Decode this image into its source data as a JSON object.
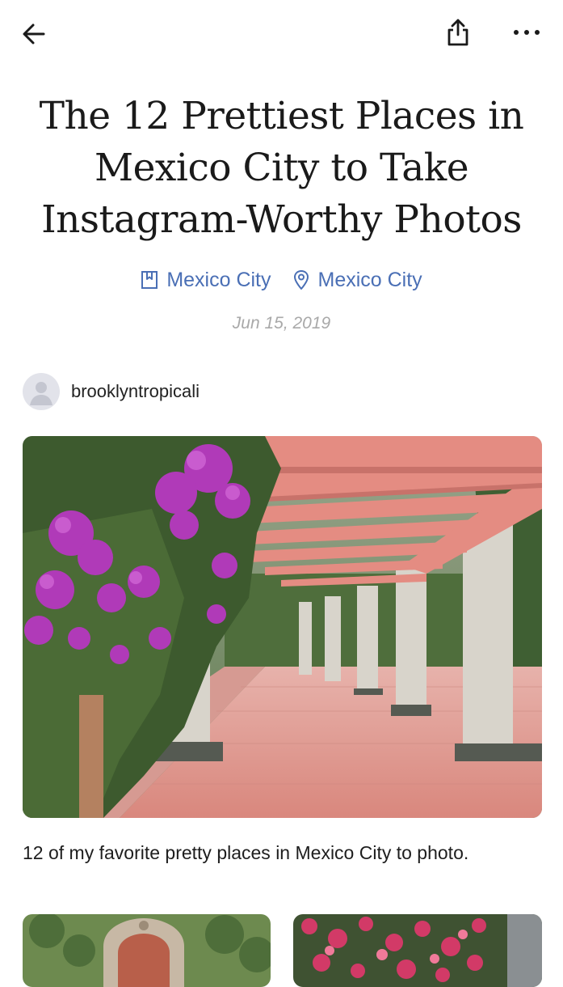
{
  "toolbar": {
    "back_icon": "arrow-left-icon",
    "share_icon": "share-icon",
    "more_icon": "more-horizontal-icon"
  },
  "article": {
    "title": "The 12 Prettiest Places in Mexico City to Take Instagram-Worthy Photos",
    "tags": [
      {
        "icon": "guide-book-icon",
        "label": "Mexico City"
      },
      {
        "icon": "location-pin-icon",
        "label": "Mexico City"
      }
    ],
    "date": "Jun 15, 2019",
    "author": {
      "name": "brooklyntropicali"
    },
    "description": "12 of my favorite pretty places in Mexico City to photo."
  },
  "colors": {
    "link": "#4a6fb5",
    "date": "#a9a9a9",
    "pergola": "#e48c82",
    "flowers": "#b03ab8"
  }
}
